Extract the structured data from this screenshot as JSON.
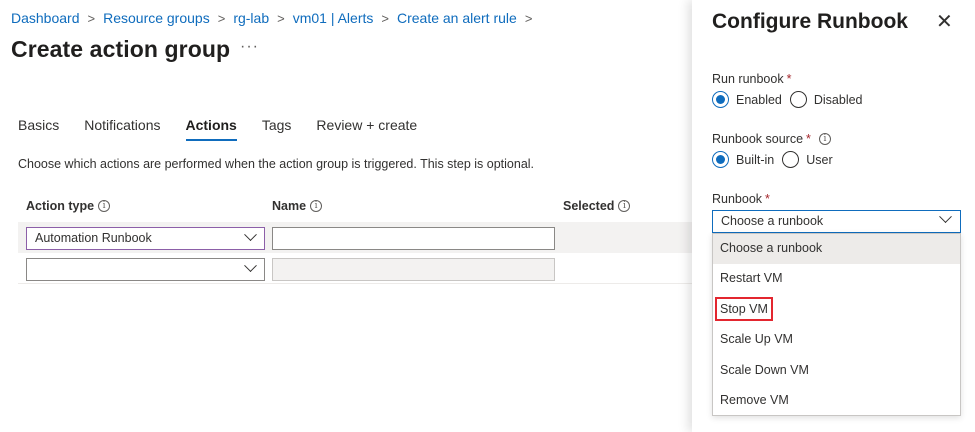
{
  "breadcrumb": [
    "Dashboard",
    "Resource groups",
    "rg-lab",
    "vm01 | Alerts",
    "Create an alert rule"
  ],
  "breadcrumb_separator": ">",
  "page": {
    "title": "Create action group",
    "more": "···"
  },
  "tabs": [
    {
      "label": "Basics",
      "active": false
    },
    {
      "label": "Notifications",
      "active": false
    },
    {
      "label": "Actions",
      "active": true
    },
    {
      "label": "Tags",
      "active": false
    },
    {
      "label": "Review + create",
      "active": false
    }
  ],
  "description": "Choose which actions are performed when the action group is triggered. This step is optional.",
  "table": {
    "headers": [
      "Action type",
      "Name",
      "Selected"
    ],
    "rows": [
      {
        "action_type": "Automation Runbook",
        "name": ""
      },
      {
        "action_type": "",
        "name": ""
      }
    ]
  },
  "panel": {
    "title": "Configure Runbook",
    "close": "✕",
    "run_runbook": {
      "label": "Run runbook",
      "required": "*",
      "options": [
        "Enabled",
        "Disabled"
      ],
      "selected": "Enabled"
    },
    "runbook_source": {
      "label": "Runbook source",
      "required": "*",
      "options": [
        "Built-in",
        "User"
      ],
      "selected": "Built-in"
    },
    "runbook": {
      "label": "Runbook",
      "required": "*",
      "value": "Choose a runbook",
      "options": [
        "Choose a runbook",
        "Restart VM",
        "Stop VM",
        "Scale Up VM",
        "Scale Down VM",
        "Remove VM"
      ],
      "highlighted": "Stop VM"
    }
  },
  "icons": {
    "info": "info-icon",
    "chevron": "chevron-down-icon",
    "close": "close-icon"
  },
  "colors": {
    "accent": "#0f6cbd",
    "required": "#a4262c",
    "highlight_box": "#e3262f"
  }
}
